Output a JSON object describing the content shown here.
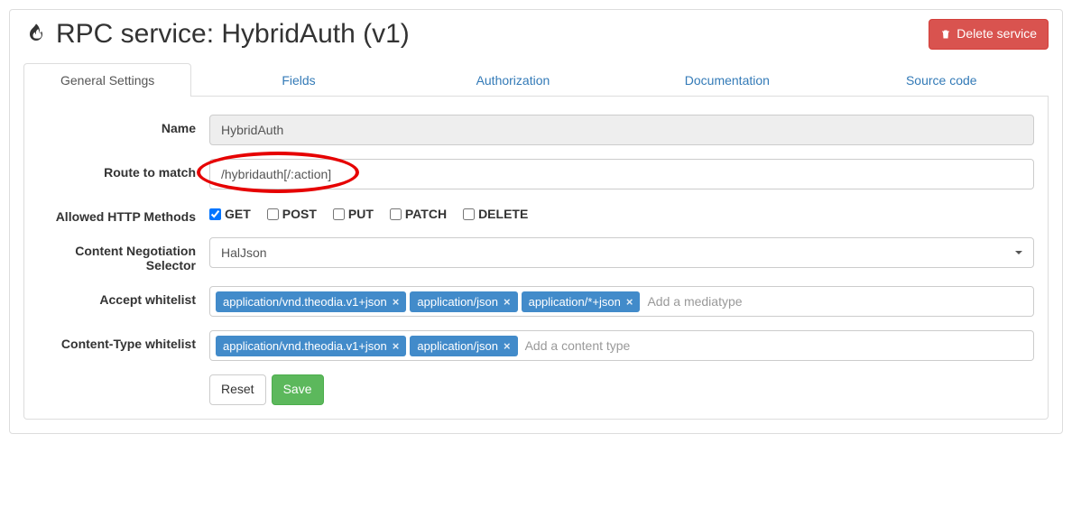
{
  "header": {
    "title": "RPC service: HybridAuth (v1)",
    "delete_label": "Delete service"
  },
  "tabs": {
    "general": "General Settings",
    "fields": "Fields",
    "authorization": "Authorization",
    "documentation": "Documentation",
    "source": "Source code"
  },
  "form": {
    "name_label": "Name",
    "name_value": "HybridAuth",
    "route_label": "Route to match",
    "route_value": "/hybridauth[/:action]",
    "methods_label": "Allowed HTTP Methods",
    "methods": {
      "get": "GET",
      "post": "POST",
      "put": "PUT",
      "patch": "PATCH",
      "delete": "DELETE"
    },
    "cn_selector_label": "Content Negotiation Selector",
    "cn_selector_value": "HalJson",
    "accept_label": "Accept whitelist",
    "accept_tags": [
      "application/vnd.theodia.v1+json",
      "application/json",
      "application/*+json"
    ],
    "accept_placeholder": "Add a mediatype",
    "ct_label": "Content-Type whitelist",
    "ct_tags": [
      "application/vnd.theodia.v1+json",
      "application/json"
    ],
    "ct_placeholder": "Add a content type",
    "reset_label": "Reset",
    "save_label": "Save"
  }
}
